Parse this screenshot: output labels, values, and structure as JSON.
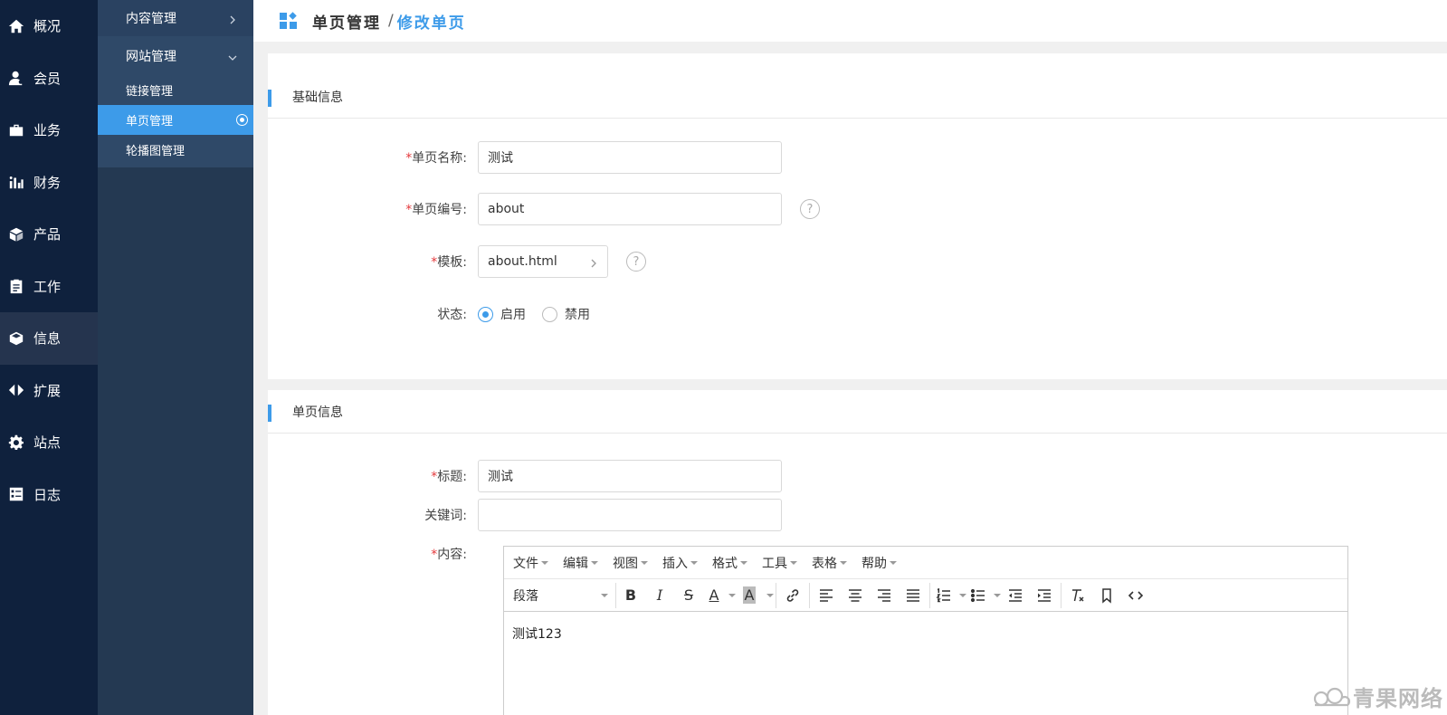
{
  "nav": {
    "items": [
      {
        "label": "概况",
        "icon": "home-icon"
      },
      {
        "label": "会员",
        "icon": "user-icon"
      },
      {
        "label": "业务",
        "icon": "briefcase-icon"
      },
      {
        "label": "财务",
        "icon": "bar-chart-icon"
      },
      {
        "label": "产品",
        "icon": "box-icon"
      },
      {
        "label": "工作",
        "icon": "clipboard-icon"
      },
      {
        "label": "信息",
        "icon": "cube-icon"
      },
      {
        "label": "扩展",
        "icon": "expand-icon"
      },
      {
        "label": "站点",
        "icon": "gear-icon"
      },
      {
        "label": "日志",
        "icon": "log-icon"
      }
    ],
    "active_index": 6
  },
  "subnav": {
    "group1": "内容管理",
    "group2": "网站管理",
    "items": [
      "链接管理",
      "单页管理",
      "轮播图管理"
    ],
    "active_index": 1
  },
  "header": {
    "title": "单页管理",
    "separator": "/",
    "subtitle": "修改单页"
  },
  "basic": {
    "section_title": "基础信息",
    "name_label": "单页名称:",
    "name_value": "测试",
    "code_label": "单页编号:",
    "code_value": "about",
    "template_label": "模板:",
    "template_value": "about.html",
    "status_label": "状态:",
    "status_enabled": "启用",
    "status_disabled": "禁用",
    "help_symbol": "?"
  },
  "page_info": {
    "section_title": "单页信息",
    "title_label": "标题:",
    "title_value": "测试",
    "keywords_label": "关键词:",
    "keywords_value": "",
    "content_label": "内容:"
  },
  "editor": {
    "menus": [
      "文件",
      "编辑",
      "视图",
      "插入",
      "格式",
      "工具",
      "表格",
      "帮助"
    ],
    "block_format": "段落",
    "bold": "B",
    "italic": "I",
    "strike": "S",
    "font_color": "A",
    "bg_color": "A",
    "content": "测试123"
  },
  "watermark": "青果网络",
  "required_mark": "*",
  "colors": {
    "nav_bg": "#0f213d",
    "subnav_bg": "#243952",
    "accent": "#3d9be9",
    "required": "#e4393c"
  }
}
